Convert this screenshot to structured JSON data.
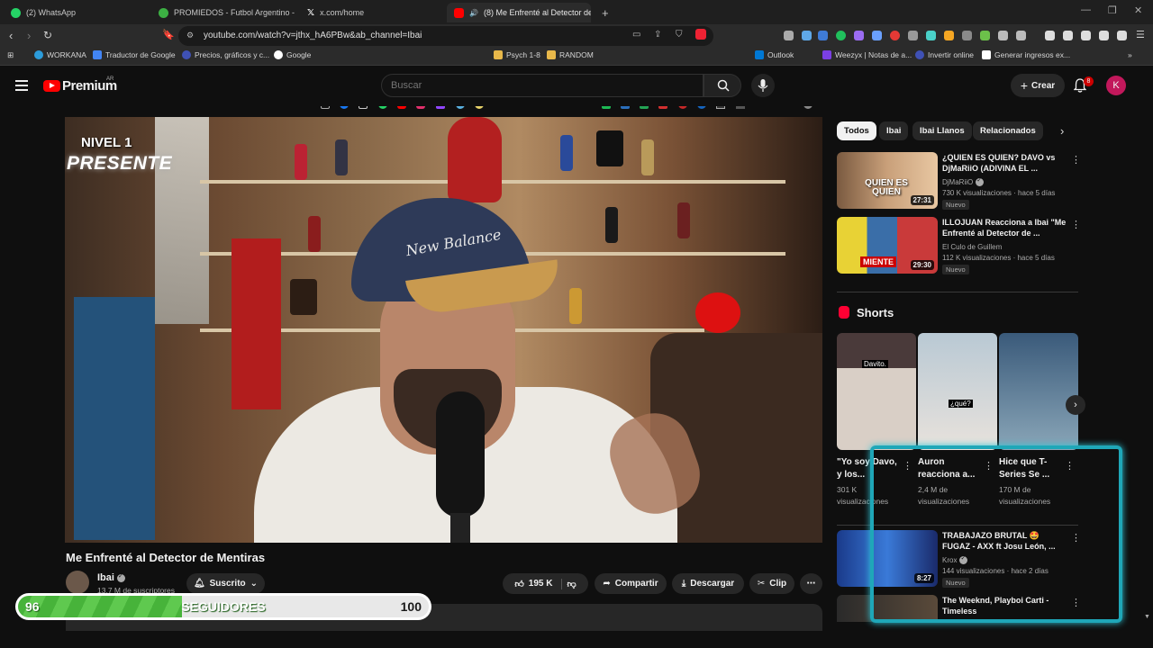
{
  "browser": {
    "tabs": [
      {
        "label": "(2) WhatsApp",
        "color": "#25d366"
      },
      {
        "label": "PROMIEDOS - Futbol Argentino - Fix",
        "color": "#3cb043"
      },
      {
        "label": "x.com/home",
        "color": "#ffffff"
      },
      {
        "label": "(8) Me Enfrenté al Detector de",
        "color": "#ff0000",
        "active": true
      }
    ],
    "new_tab": "+",
    "url": "youtube.com/watch?v=jthx_hA6PBw&ab_channel=Ibai",
    "notification_count": "8"
  },
  "bookmarks": [
    {
      "label": "WORKANA",
      "color": "#2c9cdb"
    },
    {
      "label": "Traductor de Google",
      "color": "#4285f4"
    },
    {
      "label": "Precios, gráficos y c...",
      "color": "#3f51b5"
    },
    {
      "label": "Google",
      "color": "#ffffff"
    },
    {
      "label": "Psych 1-8",
      "color": "#e8b84a"
    },
    {
      "label": "RANDOM",
      "color": "#e8b84a"
    },
    {
      "label": "Outlook",
      "color": "#0078d4"
    },
    {
      "label": "Weezyx | Notas de a...",
      "color": "#7b3fe4"
    },
    {
      "label": "Invertir online",
      "color": "#3f51b5"
    },
    {
      "label": "Generar ingresos ex...",
      "color": "#ffffff"
    }
  ],
  "header": {
    "logo_text": "Premium",
    "logo_region": "AR",
    "search_placeholder": "Buscar",
    "create_label": "Crear",
    "notifications": "8",
    "avatar_letter": "K"
  },
  "video": {
    "overlay_level": "NIVEL 1",
    "overlay_present": "PRESENTE",
    "cap_text": "New Balance",
    "title": "Me Enfrenté al Detector de Mentiras",
    "channel": "Ibai",
    "subscribers": "13,7 M de suscriptores",
    "subscribed_label": "Suscrito",
    "likes": "195 K",
    "share_label": "Compartir",
    "download_label": "Descargar",
    "clip_label": "Clip",
    "more_label": "⋯"
  },
  "followers_bar": {
    "min": "96",
    "label": "SEGUIDORES",
    "max": "100",
    "progress_fraction": 0.4
  },
  "chips": [
    {
      "label": "Todos",
      "active": true
    },
    {
      "label": "Ibai"
    },
    {
      "label": "Ibai Llanos"
    },
    {
      "label": "Relacionados"
    }
  ],
  "recommendations": [
    {
      "title": "¿QUIEN ES QUIEN? DAVO vs DjMaRiiO (ADIVINA EL ...",
      "channel": "DjMaRiiO",
      "meta": "730 K visualizaciones · hace 5 días",
      "badge": "Nuevo",
      "duration": "27:31",
      "thumb_text": "QUIEN ES QUIEN"
    },
    {
      "title": "ILLOJUAN Reacciona a Ibai \"Me Enfrenté al Detector de ...",
      "channel": "El Culo de Guillem",
      "meta": "112 K visualizaciones · hace 5 días",
      "badge": "Nuevo",
      "duration": "29:30",
      "thumb_text": "MIENTE"
    }
  ],
  "shorts": {
    "heading": "Shorts",
    "items": [
      {
        "title": "\"Yo soy Davo, y los...",
        "meta": "301 K visualizaciones",
        "thumb_text": "Davito."
      },
      {
        "title": "Auron reacciona a...",
        "meta": "2,4 M de visualizaciones",
        "thumb_text": "¿qué?"
      },
      {
        "title": "Hice que T-Series Se ...",
        "meta": "170 M de visualizaciones",
        "thumb_text": ""
      }
    ]
  },
  "more_recommendations": [
    {
      "title": "TRABAJAZO BRUTAL 🤩 FUGAZ - AXX ft Josu León, ...",
      "channel": "Krox",
      "meta": "144 visualizaciones · hace 2 días",
      "badge": "Nuevo",
      "duration": "8:27"
    },
    {
      "title": "The Weeknd, Playboi Carti - Timeless",
      "channel": "",
      "meta": "",
      "badge": "",
      "duration": ""
    }
  ]
}
